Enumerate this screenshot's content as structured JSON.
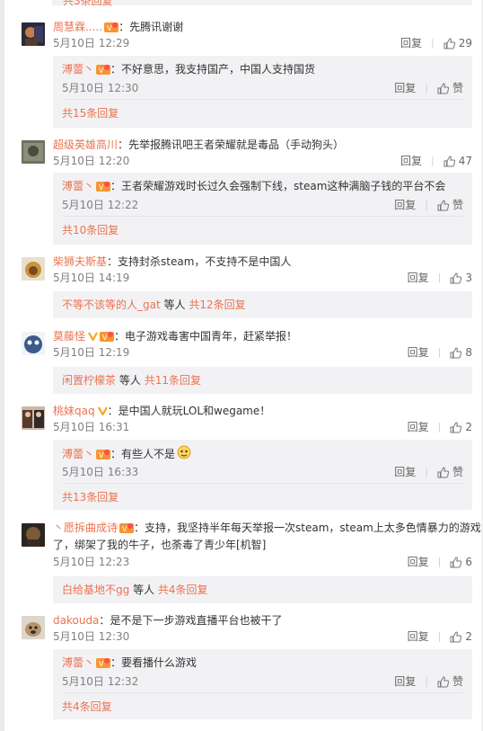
{
  "top_cut_text": "共3条回复",
  "reply_label": "回复",
  "like_label": "赞",
  "comments": [
    {
      "user": "周慧霖.....",
      "text": "先腾讯谢谢",
      "date": "5月10日 12:29",
      "likes": "29",
      "replies": [
        {
          "user": "溥蕾丶",
          "text": "不好意思，我支持国产，中国人支持国货",
          "date": "5月10日 12:30",
          "likes": "赞"
        }
      ],
      "more": "共15条回复"
    },
    {
      "user": "超级英雄高川",
      "text": "先举报腾讯吧王者荣耀就是毒品（手动狗头）",
      "date": "5月10日 12:20",
      "likes": "47",
      "replies": [
        {
          "user": "溥蕾丶",
          "text": "王者荣耀游戏时长过久会强制下线，steam这种满脑子钱的平台不会",
          "date": "5月10日 12:22",
          "likes": "赞"
        }
      ],
      "more": "共10条回复"
    },
    {
      "user": "柴狮夫斯基",
      "text": "支持封杀steam，不支持不是中国人",
      "date": "5月10日 14:19",
      "likes": "3",
      "others": {
        "user": "不等不该等的人_gat",
        "suffix": "等人",
        "more": "共12条回复"
      }
    },
    {
      "user": "莫藤怪",
      "text": "电子游戏毒害中国青年，赶紧举报！",
      "date": "5月10日 12:19",
      "likes": "8",
      "others": {
        "user": "闲置柠檬茶",
        "suffix": "等人",
        "more": "共11条回复"
      }
    },
    {
      "user": "桃妹qaq",
      "text": "是中国人就玩LOL和wegame！",
      "date": "5月10日 16:31",
      "likes": "2",
      "replies": [
        {
          "user": "溥蕾丶",
          "text": "有些人不是",
          "date": "5月10日 16:33",
          "likes": "赞"
        }
      ],
      "more": "共13条回复"
    },
    {
      "user": "丶愿拆曲成诗",
      "text_line1": "支持，我坚持半年每天举报一次steam，steam上太多色情暴力的游戏",
      "text_line2": "了，绑架了我的牛子，也荼毒了青少年[机智]",
      "date": "5月10日 12:23",
      "likes": "6",
      "others": {
        "user": "白给基地不gg",
        "suffix": "等人",
        "more": "共4条回复"
      }
    },
    {
      "user": "dakouda",
      "text": "是不是下一步游戏直播平台也被干了",
      "date": "5月10日 12:30",
      "likes": "2",
      "replies": [
        {
          "user": "溥蕾丶",
          "text": "要看播什么游戏",
          "date": "5月10日 12:32",
          "likes": "赞"
        }
      ],
      "more": "共4条回复"
    }
  ],
  "colors": {
    "accent": "#eb7350",
    "reply_bg": "#f2f2f5",
    "meta": "#808080"
  }
}
